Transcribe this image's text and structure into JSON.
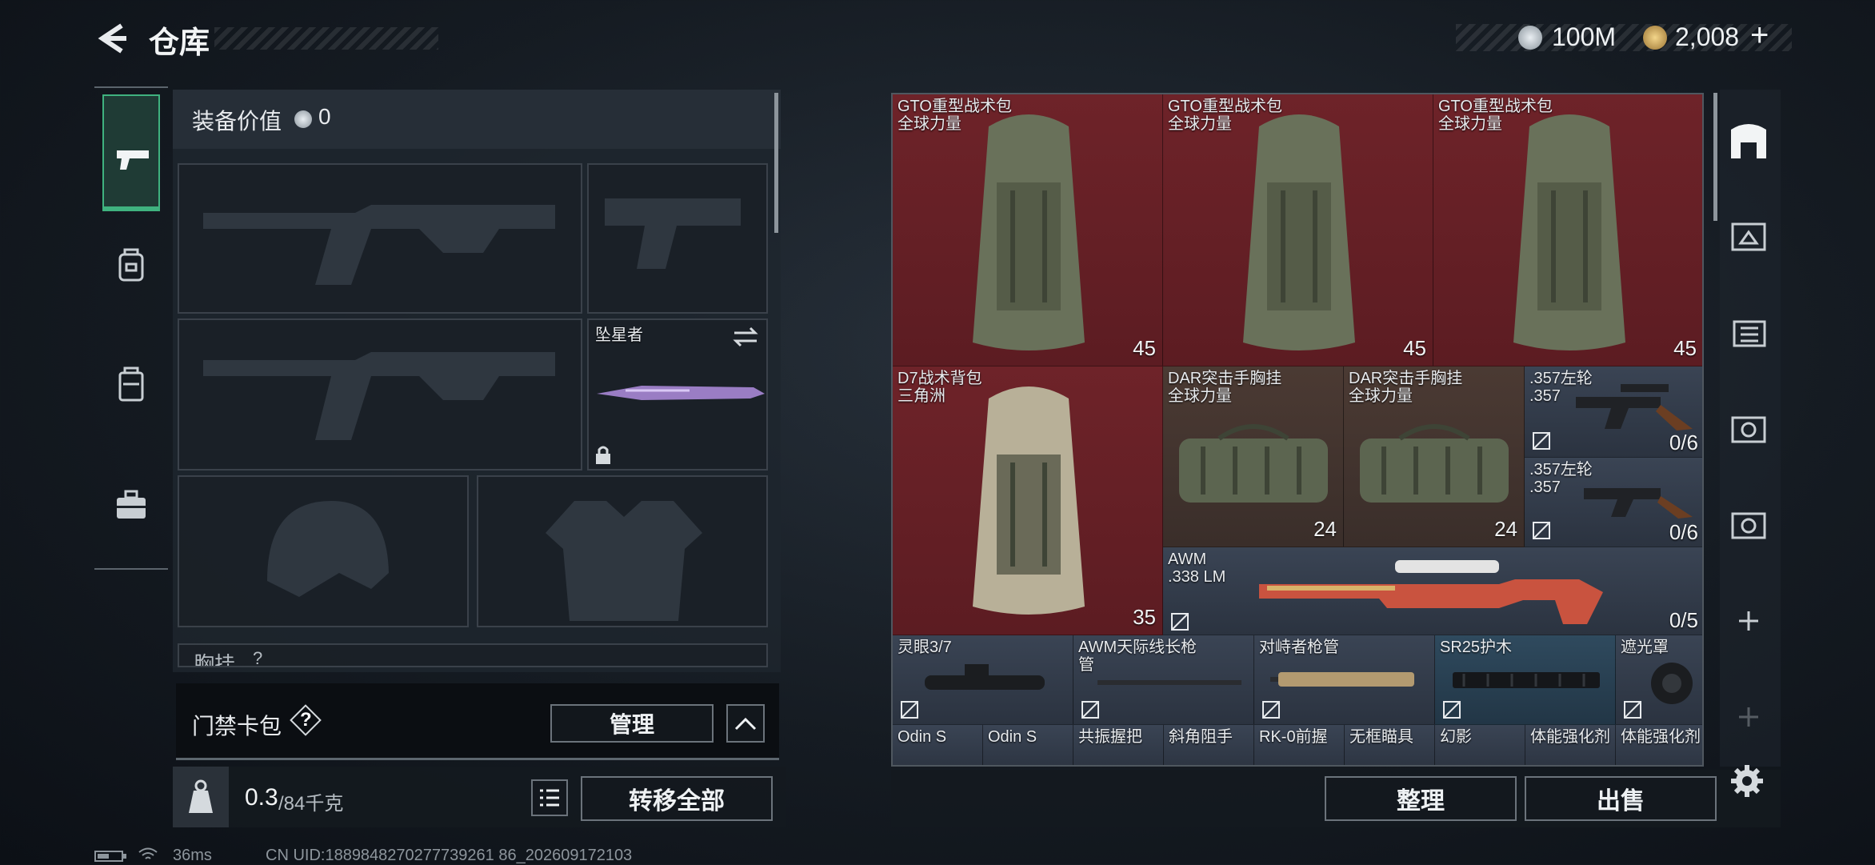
{
  "header": {
    "title": "仓库",
    "currency1": "100M",
    "currency2": "2,008",
    "plus": "+"
  },
  "loadout": {
    "value_label": "装备价值",
    "value": "0",
    "melee_name": "坠星者",
    "partial_label": "胸挂",
    "partial_q": "?",
    "keycard_label": "门禁卡包",
    "keycard_q": "?",
    "manage_label": "管理",
    "weight": "0.3",
    "weight_max": "/84千克",
    "transfer_label": "转移全部"
  },
  "items": [
    {
      "name": "GTO重型战术包",
      "sub": "全球力量",
      "count": "45"
    },
    {
      "name": "GTO重型战术包",
      "sub": "全球力量",
      "count": "45"
    },
    {
      "name": "GTO重型战术包",
      "sub": "全球力量",
      "count": "45"
    },
    {
      "name": "D7战术背包",
      "sub": "三角洲",
      "count": "35"
    },
    {
      "name": "DAR突击手胸挂",
      "sub": "全球力量",
      "count": "24"
    },
    {
      "name": "DAR突击手胸挂",
      "sub": "全球力量",
      "count": "24"
    },
    {
      "name": ".357左轮",
      "sub": ".357",
      "count": "0/6"
    },
    {
      "name": ".357左轮",
      "sub": ".357",
      "count": "0/6"
    },
    {
      "name": "AWM",
      "sub": ".338 LM",
      "count": "0/5"
    }
  ],
  "attachments": [
    "灵眼3/7",
    "AWM天际线长枪管",
    "对峙者枪管",
    "SR25护木",
    "遮光罩"
  ],
  "bottom_row": [
    "Odin S",
    "Odin S",
    "共振握把",
    "斜角阻手",
    "RK-0前握",
    "无框瞄具",
    "幻影",
    "体能强化剂",
    "体能强化剂"
  ],
  "actions": {
    "sort": "整理",
    "sell": "出售"
  },
  "status": {
    "ping": "36ms",
    "uid": "CN UID:1889848270277739261 86_202609172103"
  },
  "colors": {
    "high_rarity": "#6e2329",
    "mid_rarity": "#4b3a33",
    "blue_rarity": "#2f4a5e",
    "accent_green": "#3fb27f"
  }
}
